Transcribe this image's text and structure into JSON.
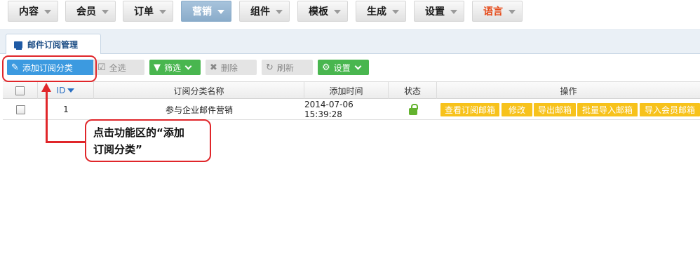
{
  "topnav": {
    "items": [
      {
        "label": "内容"
      },
      {
        "label": "会员"
      },
      {
        "label": "订单"
      },
      {
        "label": "营销"
      },
      {
        "label": "组件"
      },
      {
        "label": "模板"
      },
      {
        "label": "生成"
      },
      {
        "label": "设置"
      },
      {
        "label": "语言"
      }
    ],
    "active": "营销"
  },
  "tab": {
    "label": "邮件订阅管理"
  },
  "toolbar": {
    "add": "添加订阅分类",
    "select_all": "全选",
    "filter": "筛选",
    "delete": "删除",
    "refresh": "刷新",
    "settings": "设置"
  },
  "table": {
    "headers": {
      "id": "ID",
      "name": "订阅分类名称",
      "time": "添加时间",
      "status": "状态",
      "actions": "操作"
    },
    "rows": [
      {
        "id": "1",
        "name": "参与企业邮件营销",
        "time": "2014-07-06 15:39:28",
        "status_icon": "unlocked-icon",
        "actions": [
          "查看订阅邮箱",
          "修改",
          "导出邮箱",
          "批量导入邮箱",
          "导入会员邮箱"
        ]
      }
    ]
  },
  "annotation": {
    "line1": "点击功能区的“添加",
    "line2": "订阅分类”"
  },
  "colors": {
    "accent_blue": "#3c9ae0",
    "green": "#49b64f",
    "action_yellow": "#f7c21b",
    "annotation_red": "#e0262a",
    "language_orange": "#e64a19"
  }
}
